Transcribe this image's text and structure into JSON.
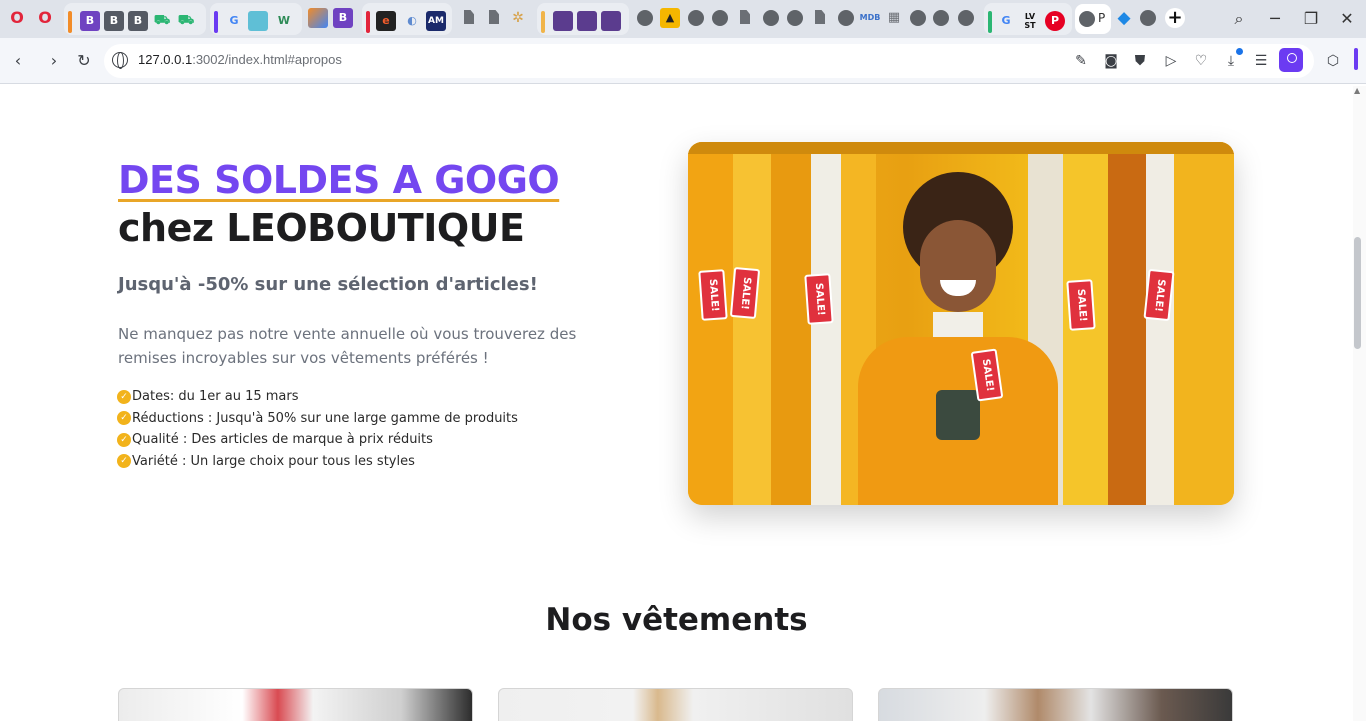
{
  "browser": {
    "url_host": "127.0.0.1",
    "url_path": ":3002/index.html#apropos",
    "active_tab_label": "P",
    "tab_letters": [
      "B",
      "B",
      "B",
      "G",
      "W",
      "e",
      "AM",
      "MDB",
      "G",
      "LV ST"
    ]
  },
  "hero": {
    "title_accent": "DES SOLDES A GOGO",
    "title_rest": " chez LEOBOUTIQUE",
    "subtitle": "Jusqu'à -50% sur une sélection d'articles!",
    "description": "Ne manquez pas notre vente annuelle où vous trouverez des remises incroyables sur vos vêtements préférés !",
    "features": [
      "Dates: du 1er au 15 mars",
      "Réductions : Jusqu'à 50% sur une large gamme de produits",
      "Qualité : Des articles de marque à prix réduits",
      "Variété : Un large choix pour tous les styles"
    ],
    "image_tags": [
      "SALE!",
      "SALE!",
      "SALE!",
      "SALE!",
      "SALE!",
      "SALE!"
    ]
  },
  "section": {
    "title": "Nos vêtements"
  },
  "colors": {
    "accent_purple": "#7447f0",
    "accent_underline": "#e9a628",
    "check_yellow": "#f2b31b"
  }
}
